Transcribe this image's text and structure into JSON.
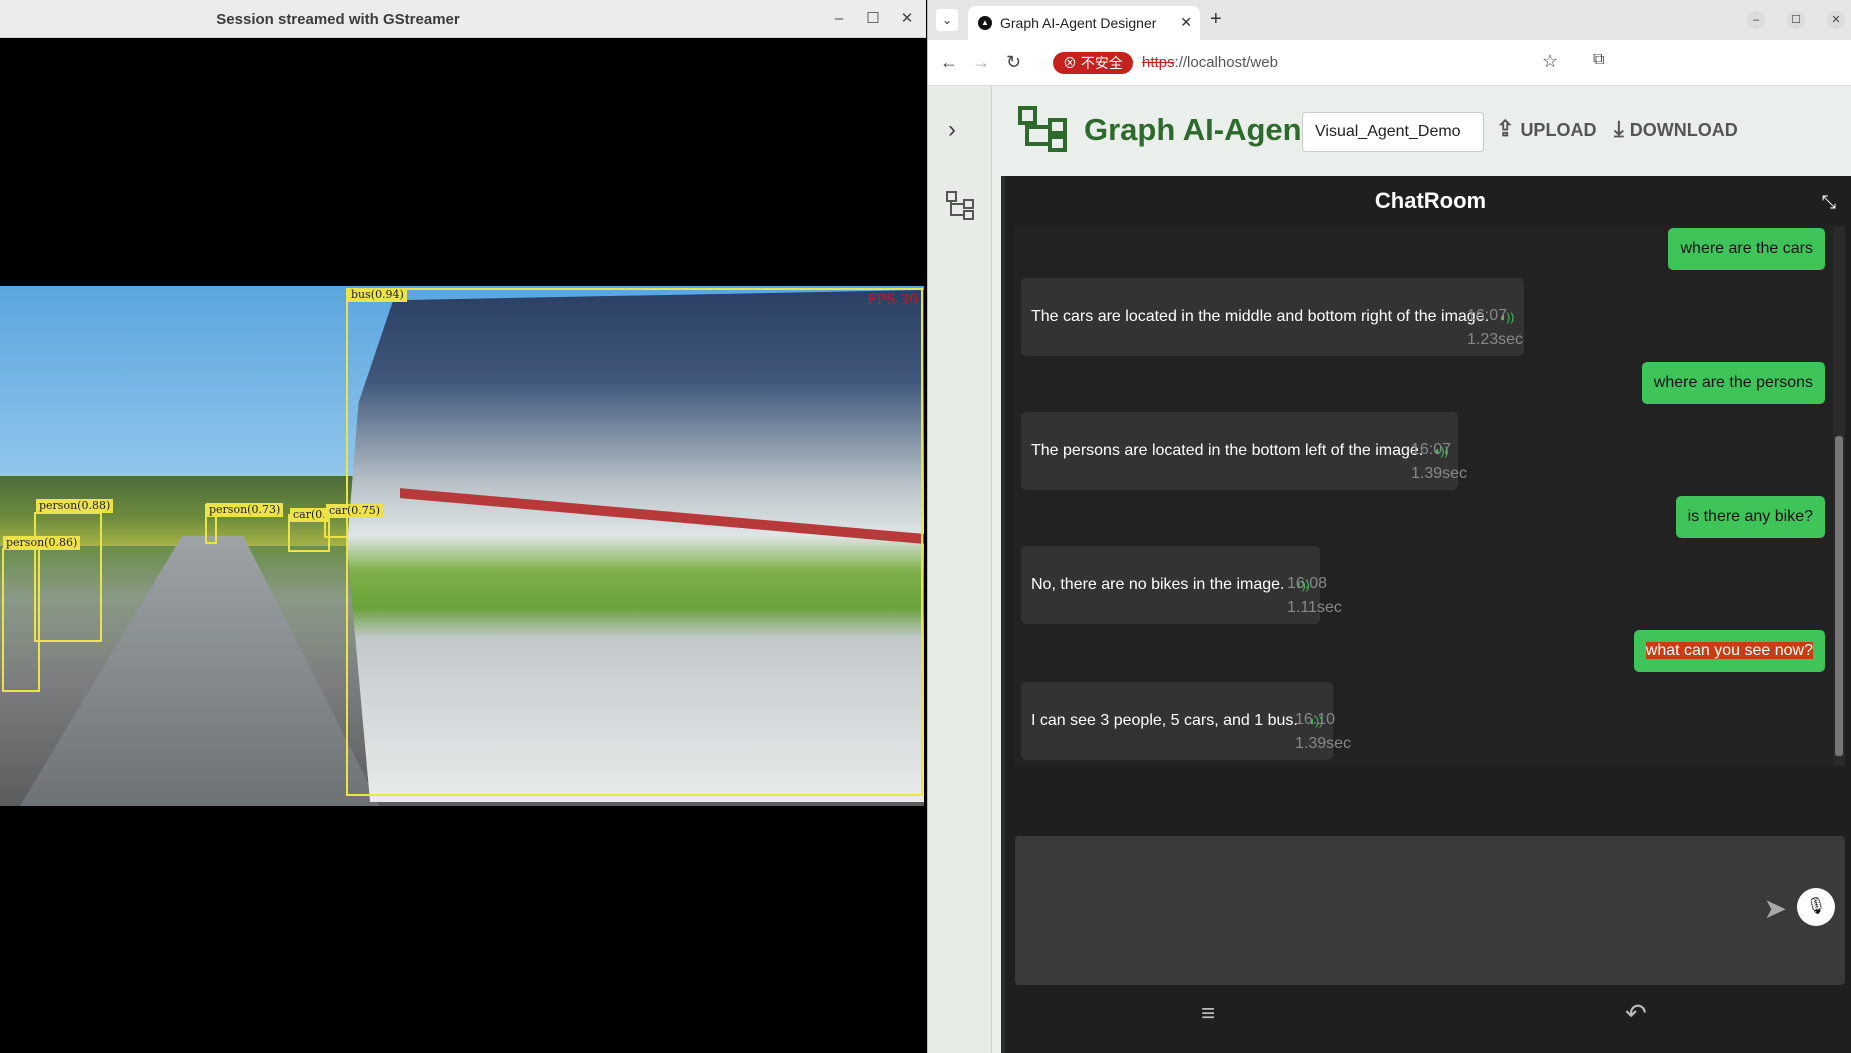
{
  "gst": {
    "title": "Session streamed with GStreamer",
    "fps": "FPS 30",
    "detections": [
      "bus(0.94)",
      "person(0.88)",
      "person(0.86)",
      "person(0.73)",
      "car(0.",
      "car(0.75)"
    ]
  },
  "browser": {
    "tab_title": "Graph AI-Agent Designer",
    "security_label": "不安全",
    "url_scheme": "https",
    "url_rest": "://localhost/web"
  },
  "app": {
    "title": "Graph AI-Agent D...",
    "project_name": "Visual_Agent_Demo",
    "upload_label": "UPLOAD",
    "download_label": "DOWNLOAD"
  },
  "chat": {
    "title": "ChatRoom",
    "messages": [
      {
        "user": "where are the cars"
      },
      {
        "bot": "The cars are located in the middle and bottom right of the image.",
        "time": "16:07",
        "latency": "1.23sec"
      },
      {
        "user": "where are the persons"
      },
      {
        "bot": "The persons are located in the bottom left of the image.",
        "time": "16:07",
        "latency": "1.39sec"
      },
      {
        "user": "is there any bike?"
      },
      {
        "bot": "No, there are no bikes in the image.",
        "time": "16:08",
        "latency": "1.11sec"
      },
      {
        "user": "what can you see now?"
      },
      {
        "bot": "I can see 3 people, 5 cars, and 1 bus.",
        "time": "16:10",
        "latency": "1.39sec"
      }
    ]
  },
  "colors": {
    "accent": "#2e6a2e",
    "user_bubble": "#3fc45a",
    "chat_bg": "#1f1f1f",
    "detection": "#ece34a"
  }
}
